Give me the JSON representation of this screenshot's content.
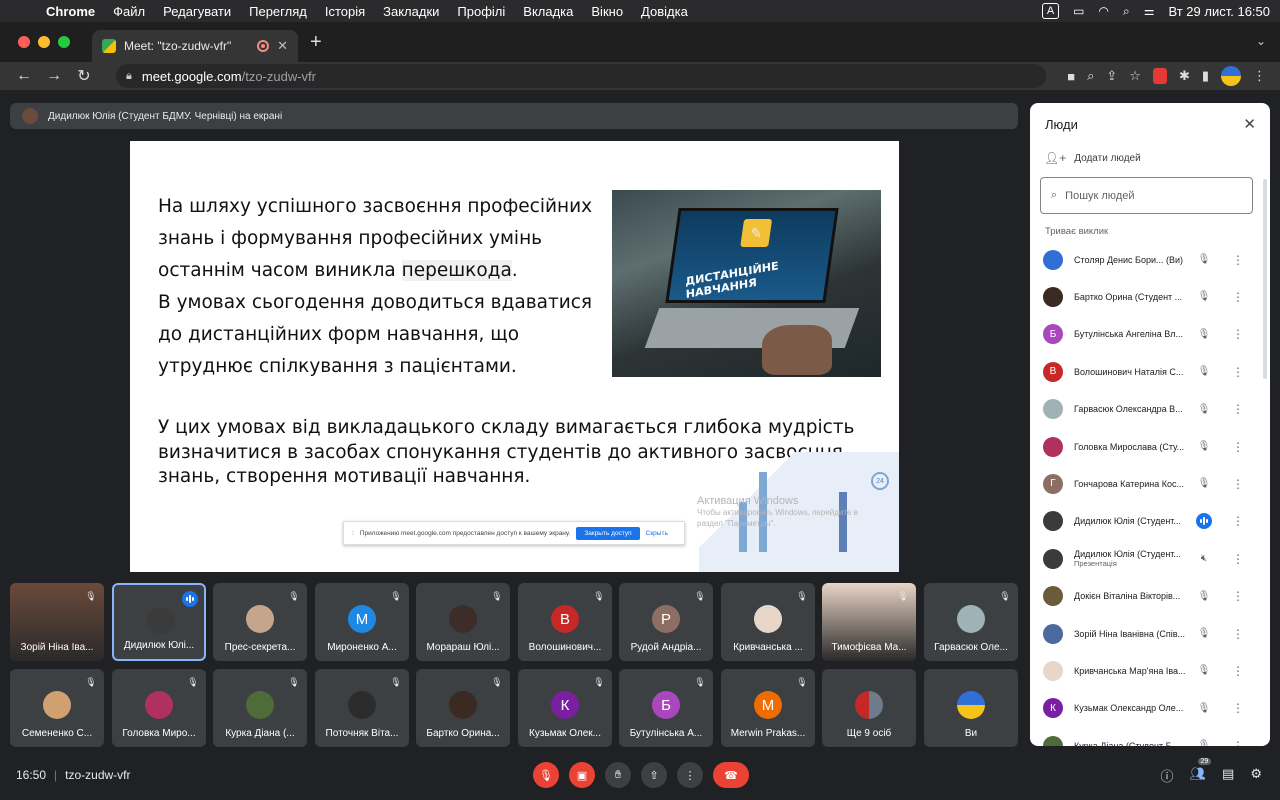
{
  "menubar": {
    "apple": "",
    "app": "Chrome",
    "items": [
      "Файл",
      "Редагувати",
      "Перегляд",
      "Історія",
      "Закладки",
      "Профілі",
      "Вкладка",
      "Вікно",
      "Довідка"
    ],
    "input_indicator": "A",
    "datetime": "Вт 29 лист.  16:50"
  },
  "tab": {
    "title": "Meet: \"tzo-zudw-vfr\"",
    "close": "✕",
    "new": "+"
  },
  "omnibox": {
    "host": "meet.google.com",
    "path": "/tzo-zudw-vfr"
  },
  "presenting_banner": "Дидилюк Юлія (Студент БДМУ. Чернівці) на екрані",
  "slide": {
    "para1_a": "На шляху успішного засвоєння професійних знань і формування професійних умінь останнім часом виникла ",
    "para1_highlight": "перешкода",
    "para1_b": ".",
    "para1_c": "В умовах сьогодення доводиться вдаватися до дистанційних форм навчання, що утруднює спілкування з пацієнтами.",
    "para2": "У цих умовах від викладацького складу вимагається глибока мудрість визначитися в засобах спонукання студентів до активного засвоєння знань, створення мотивації навчання.",
    "image_caption": "ДИСТАНЦІЙНЕ НАВЧАННЯ",
    "activation_title": "Активация Windows",
    "activation_sub": "Чтобы активировать Windows, перейдите в раздел \"Параметры\".",
    "badge": "24",
    "share_text": "Приложению meet.google.com предоставлен доступ к вашему экрану.",
    "share_button": "Закрыть доступ",
    "share_hide": "Скрыть"
  },
  "tiles": [
    {
      "name": "Зорій Ніна Іва...",
      "kind": "video",
      "color": "#6a4a3a"
    },
    {
      "name": "Дидилюк Юлі...",
      "kind": "photo",
      "color": "#3b3b3b",
      "active": true
    },
    {
      "name": "Прес-секрета...",
      "kind": "photo",
      "color": "#c7a58a"
    },
    {
      "name": "Мироненко А...",
      "kind": "letter",
      "letter": "M",
      "color": "#1e88e5"
    },
    {
      "name": "Морараш Юлі...",
      "kind": "photo",
      "color": "#3e2c28"
    },
    {
      "name": "Волошинович...",
      "kind": "letter",
      "letter": "В",
      "color": "#c62828"
    },
    {
      "name": "Рудой Андріа...",
      "kind": "letter",
      "letter": "Р",
      "color": "#8d6e63"
    },
    {
      "name": "Кривчанська ...",
      "kind": "photo",
      "color": "#e8d7c8"
    },
    {
      "name": "Тимофієва Ма...",
      "kind": "video",
      "color": "#e9d4c6"
    },
    {
      "name": "Гарвасюк Оле...",
      "kind": "photo",
      "color": "#9fb2b5"
    },
    {
      "name": "Семененко С...",
      "kind": "photo",
      "color": "#d0a070"
    },
    {
      "name": "Головка Миро...",
      "kind": "photo",
      "color": "#b03060"
    },
    {
      "name": "Курка Діана (...",
      "kind": "photo",
      "color": "#4f6b3a"
    },
    {
      "name": "Поточняк Віта...",
      "kind": "photo",
      "color": "#2c2c2c"
    },
    {
      "name": "Бартко Орина...",
      "kind": "photo",
      "color": "#3a2a22"
    },
    {
      "name": "Кузьмак Олек...",
      "kind": "letter",
      "letter": "К",
      "color": "#7b1fa2"
    },
    {
      "name": "Бутулінська А...",
      "kind": "letter",
      "letter": "Б",
      "color": "#ab47bc"
    },
    {
      "name": "Merwin Prakas...",
      "kind": "letter",
      "letter": "M",
      "color": "#ef6c00"
    },
    {
      "name": "Ще 9 осіб",
      "kind": "more",
      "color": "#3c4043"
    },
    {
      "name": "Ви",
      "kind": "flag",
      "color": "#2f6fd6"
    }
  ],
  "bottombar": {
    "time": "16:50",
    "separator": "|",
    "code": "tzo-zudw-vfr",
    "people_count": "29"
  },
  "panel": {
    "title": "Люди",
    "add_people": "Додати людей",
    "search_placeholder": "Пошук людей",
    "section": "Триває виклик",
    "participants": [
      {
        "name": "Столяр Денис Бори...  (Ви)",
        "color": "#2f6fd6",
        "letter": "",
        "mic": "muted"
      },
      {
        "name": "Бартко Орина (Студент ...",
        "color": "#3a2a22",
        "letter": "",
        "mic": "muted"
      },
      {
        "name": "Бутулінська Ангеліна Вл...",
        "color": "#ab47bc",
        "letter": "Б",
        "mic": "muted"
      },
      {
        "name": "Волошинович Наталія С...",
        "color": "#c62828",
        "letter": "В",
        "mic": "muted"
      },
      {
        "name": "Гарвасюк Олександра В...",
        "color": "#9fb2b5",
        "letter": "",
        "mic": "muted"
      },
      {
        "name": "Головка Мирослава (Сту...",
        "color": "#b03060",
        "letter": "",
        "mic": "muted"
      },
      {
        "name": "Гончарова Катерина Кос...",
        "color": "#8d6e63",
        "letter": "Г",
        "mic": "muted"
      },
      {
        "name": "Дидилюк Юлія (Студент...",
        "color": "#3b3b3b",
        "letter": "",
        "mic": "speaking"
      },
      {
        "name": "Дидилюк Юлія (Студент...",
        "sub": "Презентація",
        "color": "#3b3b3b",
        "letter": "",
        "mic": "presenting"
      },
      {
        "name": "Докієн Віталіна Вікторів...",
        "color": "#6b5b3a",
        "letter": "",
        "mic": "muted"
      },
      {
        "name": "Зорій Ніна Іванівна (Спів...",
        "color": "#4a6aa0",
        "letter": "",
        "mic": "muted"
      },
      {
        "name": "Кривчанська Мар'яна Іва...",
        "color": "#e8d7c8",
        "letter": "",
        "mic": "muted"
      },
      {
        "name": "Кузьмак Олександр Оле...",
        "color": "#7b1fa2",
        "letter": "К",
        "mic": "muted"
      },
      {
        "name": "Курка Діана (Студент Б...",
        "color": "#4f6b3a",
        "letter": "",
        "mic": "muted"
      }
    ]
  },
  "icons": {
    "mic_muted": "mic-off-icon",
    "more": "more-vert-icon",
    "close": "close-icon",
    "search": "search-icon",
    "add_person": "person-add-icon"
  }
}
